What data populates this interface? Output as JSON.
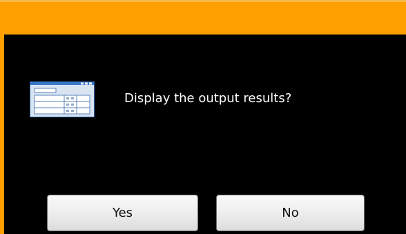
{
  "dialog": {
    "message": "Display the output results?",
    "icon": "table-window-icon",
    "yes_label": "Yes",
    "no_label": "No"
  },
  "colors": {
    "title_bar": "#ff9f00",
    "background": "#000000",
    "text": "#ffffff"
  }
}
